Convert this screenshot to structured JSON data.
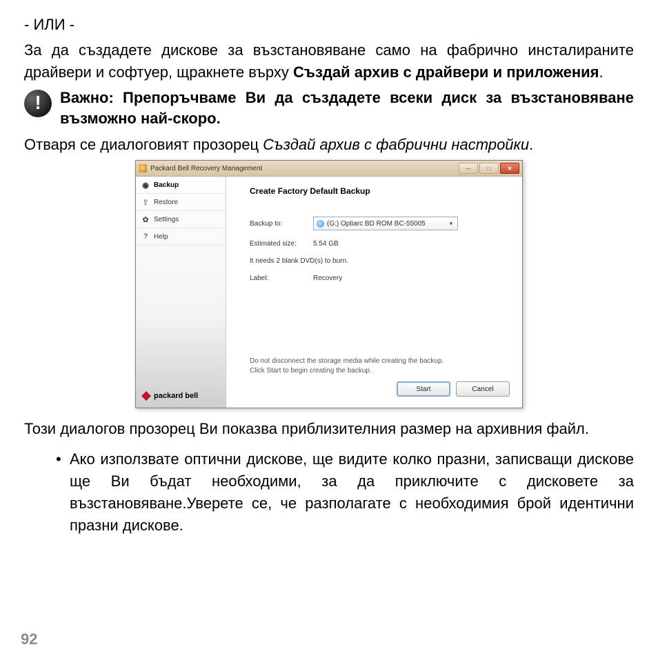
{
  "doc": {
    "or_line": "- ИЛИ -",
    "para1_a": "За да създадете дискове за възстановяване само на фабрично инсталираните драйвери и софтуер, щракнете върху ",
    "para1_b_bold": "Създай архив с драйвери и приложения",
    "para1_c": ".",
    "important": "Важно: Препоръчваме Ви да създадете всеки диск за възстановяване възможно най-скоро.",
    "para2_a": "Отваря се диалоговият прозорец ",
    "para2_b_italic": "Създай архив с фабрични настройки",
    "para2_c": ".",
    "para3": "Този диалогов прозорец Ви показва приблизителния размер на архивния файл.",
    "bullet1": "Ако използвате оптични дискове, ще видите колко празни, записващи дискове ще Ви бъдат необходими, за да приключите с дисковете за възстановяване.Уверете се, че разполагате с необходимия брой идентични празни дискове.",
    "page_number": "92"
  },
  "window": {
    "title": "Packard Bell Recovery Management",
    "sidebar": {
      "items": [
        {
          "label": "Backup",
          "icon": "◉"
        },
        {
          "label": "Restore",
          "icon": "⇧"
        },
        {
          "label": "Settings",
          "icon": "✿"
        },
        {
          "label": "Help",
          "icon": "?"
        }
      ],
      "brand": "packard bell"
    },
    "content": {
      "heading": "Create Factory Default Backup",
      "backup_to_label": "Backup to:",
      "backup_to_value": "(G:) Optiarc  BD ROM BC-55005",
      "estimated_label": "Estimated size:",
      "estimated_value": "5.54 GB",
      "needs_hint": "It needs 2 blank DVD(s) to burn.",
      "label_label": "Label:",
      "label_value": "Recovery",
      "footer_line1": "Do not disconnect the storage media while creating the backup.",
      "footer_line2": "Click Start to begin creating the backup.",
      "btn_start": "Start",
      "btn_cancel": "Cancel"
    }
  }
}
